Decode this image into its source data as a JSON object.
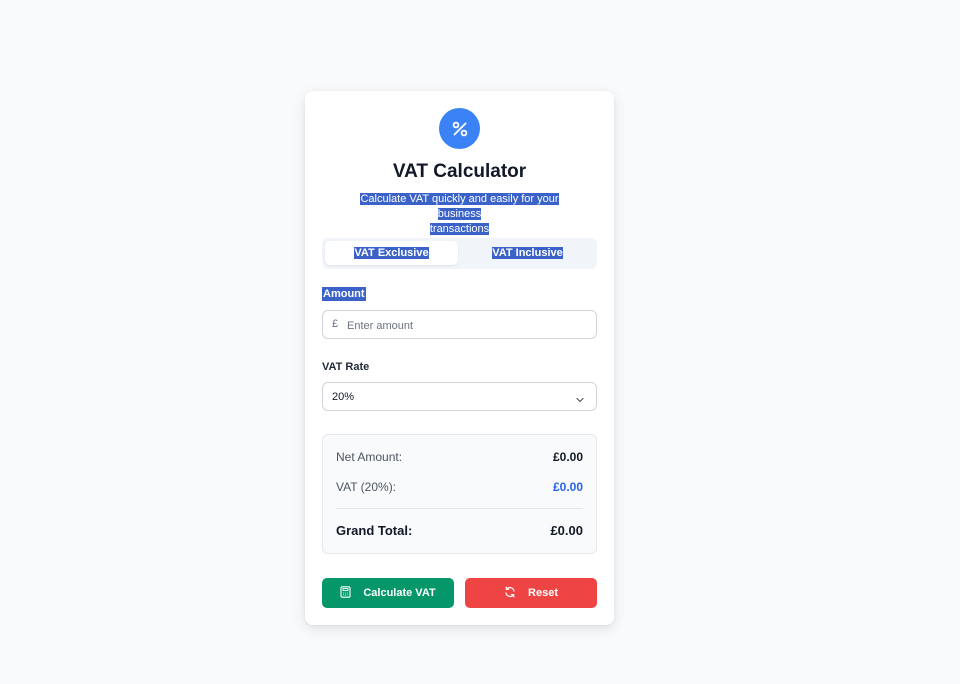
{
  "header": {
    "title": "VAT Calculator",
    "subtitle_line1": "Calculate VAT quickly and easily for your business",
    "subtitle_line2": "transactions",
    "icon": "percent-icon",
    "accent_color": "#3b82f6"
  },
  "tabs": [
    {
      "label": "VAT Exclusive",
      "active": true
    },
    {
      "label": "VAT Inclusive",
      "active": false
    }
  ],
  "amount": {
    "label": "Amount",
    "currency_symbol": "£",
    "placeholder": "Enter amount",
    "value": ""
  },
  "vat_rate": {
    "label": "VAT Rate",
    "selected": "20%"
  },
  "results": {
    "net_label": "Net Amount:",
    "net_value": "£0.00",
    "vat_label": "VAT (20%):",
    "vat_value": "£0.00",
    "total_label": "Grand Total:",
    "total_value": "£0.00"
  },
  "buttons": {
    "calculate_label": "Calculate VAT",
    "calculate_icon": "calculator-icon",
    "calculate_color": "#059669",
    "reset_label": "Reset",
    "reset_icon": "refresh-icon",
    "reset_color": "#ef4444"
  }
}
